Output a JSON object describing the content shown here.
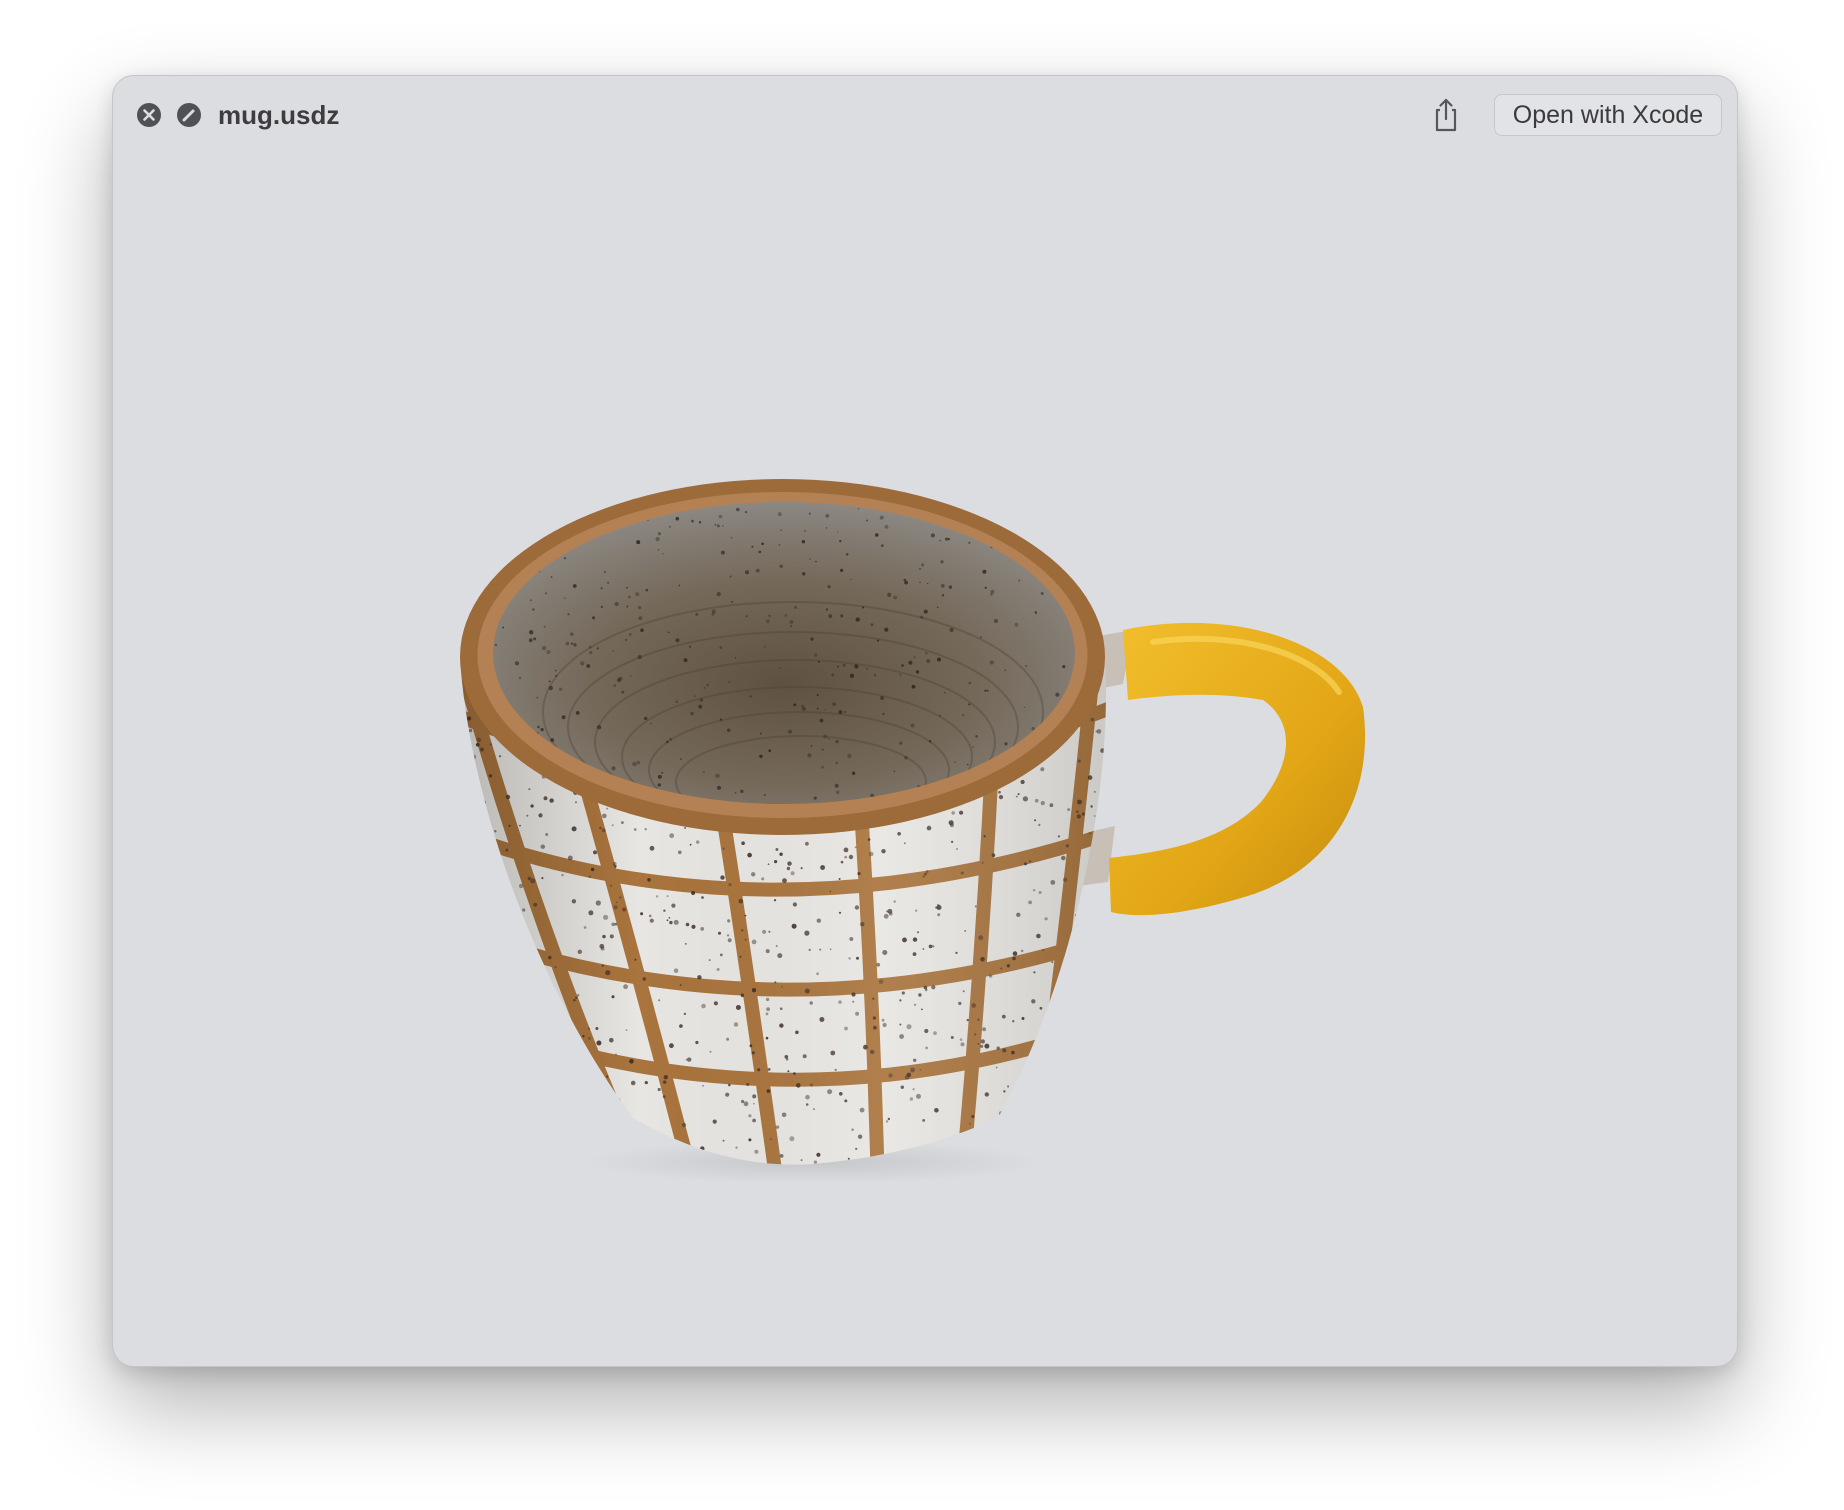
{
  "window": {
    "title": "mug.usdz",
    "open_with_label": "Open with Xcode",
    "background_color": "#dcdde0"
  },
  "icons": {
    "close": "close-circle-icon",
    "markup": "markup-pencil-icon",
    "share": "share-icon"
  },
  "model": {
    "name": "mug",
    "body_color": "#e8e6e2",
    "grid_color": "#a9743d",
    "handle_color": "#e7ad1c"
  }
}
